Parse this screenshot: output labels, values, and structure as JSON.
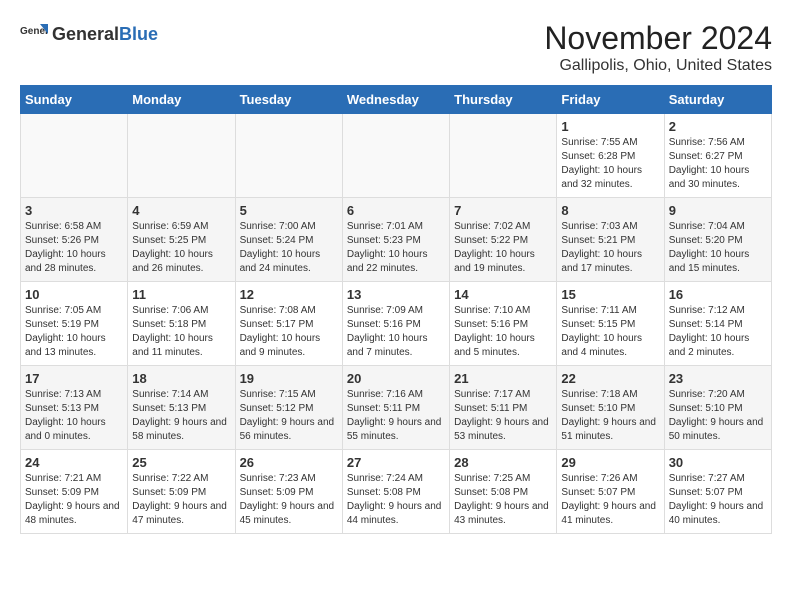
{
  "header": {
    "logo_general": "General",
    "logo_blue": "Blue",
    "month": "November 2024",
    "location": "Gallipolis, Ohio, United States"
  },
  "weekdays": [
    "Sunday",
    "Monday",
    "Tuesday",
    "Wednesday",
    "Thursday",
    "Friday",
    "Saturday"
  ],
  "weeks": [
    [
      {
        "day": "",
        "info": ""
      },
      {
        "day": "",
        "info": ""
      },
      {
        "day": "",
        "info": ""
      },
      {
        "day": "",
        "info": ""
      },
      {
        "day": "",
        "info": ""
      },
      {
        "day": "1",
        "info": "Sunrise: 7:55 AM\nSunset: 6:28 PM\nDaylight: 10 hours and 32 minutes."
      },
      {
        "day": "2",
        "info": "Sunrise: 7:56 AM\nSunset: 6:27 PM\nDaylight: 10 hours and 30 minutes."
      }
    ],
    [
      {
        "day": "3",
        "info": "Sunrise: 6:58 AM\nSunset: 5:26 PM\nDaylight: 10 hours and 28 minutes."
      },
      {
        "day": "4",
        "info": "Sunrise: 6:59 AM\nSunset: 5:25 PM\nDaylight: 10 hours and 26 minutes."
      },
      {
        "day": "5",
        "info": "Sunrise: 7:00 AM\nSunset: 5:24 PM\nDaylight: 10 hours and 24 minutes."
      },
      {
        "day": "6",
        "info": "Sunrise: 7:01 AM\nSunset: 5:23 PM\nDaylight: 10 hours and 22 minutes."
      },
      {
        "day": "7",
        "info": "Sunrise: 7:02 AM\nSunset: 5:22 PM\nDaylight: 10 hours and 19 minutes."
      },
      {
        "day": "8",
        "info": "Sunrise: 7:03 AM\nSunset: 5:21 PM\nDaylight: 10 hours and 17 minutes."
      },
      {
        "day": "9",
        "info": "Sunrise: 7:04 AM\nSunset: 5:20 PM\nDaylight: 10 hours and 15 minutes."
      }
    ],
    [
      {
        "day": "10",
        "info": "Sunrise: 7:05 AM\nSunset: 5:19 PM\nDaylight: 10 hours and 13 minutes."
      },
      {
        "day": "11",
        "info": "Sunrise: 7:06 AM\nSunset: 5:18 PM\nDaylight: 10 hours and 11 minutes."
      },
      {
        "day": "12",
        "info": "Sunrise: 7:08 AM\nSunset: 5:17 PM\nDaylight: 10 hours and 9 minutes."
      },
      {
        "day": "13",
        "info": "Sunrise: 7:09 AM\nSunset: 5:16 PM\nDaylight: 10 hours and 7 minutes."
      },
      {
        "day": "14",
        "info": "Sunrise: 7:10 AM\nSunset: 5:16 PM\nDaylight: 10 hours and 5 minutes."
      },
      {
        "day": "15",
        "info": "Sunrise: 7:11 AM\nSunset: 5:15 PM\nDaylight: 10 hours and 4 minutes."
      },
      {
        "day": "16",
        "info": "Sunrise: 7:12 AM\nSunset: 5:14 PM\nDaylight: 10 hours and 2 minutes."
      }
    ],
    [
      {
        "day": "17",
        "info": "Sunrise: 7:13 AM\nSunset: 5:13 PM\nDaylight: 10 hours and 0 minutes."
      },
      {
        "day": "18",
        "info": "Sunrise: 7:14 AM\nSunset: 5:13 PM\nDaylight: 9 hours and 58 minutes."
      },
      {
        "day": "19",
        "info": "Sunrise: 7:15 AM\nSunset: 5:12 PM\nDaylight: 9 hours and 56 minutes."
      },
      {
        "day": "20",
        "info": "Sunrise: 7:16 AM\nSunset: 5:11 PM\nDaylight: 9 hours and 55 minutes."
      },
      {
        "day": "21",
        "info": "Sunrise: 7:17 AM\nSunset: 5:11 PM\nDaylight: 9 hours and 53 minutes."
      },
      {
        "day": "22",
        "info": "Sunrise: 7:18 AM\nSunset: 5:10 PM\nDaylight: 9 hours and 51 minutes."
      },
      {
        "day": "23",
        "info": "Sunrise: 7:20 AM\nSunset: 5:10 PM\nDaylight: 9 hours and 50 minutes."
      }
    ],
    [
      {
        "day": "24",
        "info": "Sunrise: 7:21 AM\nSunset: 5:09 PM\nDaylight: 9 hours and 48 minutes."
      },
      {
        "day": "25",
        "info": "Sunrise: 7:22 AM\nSunset: 5:09 PM\nDaylight: 9 hours and 47 minutes."
      },
      {
        "day": "26",
        "info": "Sunrise: 7:23 AM\nSunset: 5:09 PM\nDaylight: 9 hours and 45 minutes."
      },
      {
        "day": "27",
        "info": "Sunrise: 7:24 AM\nSunset: 5:08 PM\nDaylight: 9 hours and 44 minutes."
      },
      {
        "day": "28",
        "info": "Sunrise: 7:25 AM\nSunset: 5:08 PM\nDaylight: 9 hours and 43 minutes."
      },
      {
        "day": "29",
        "info": "Sunrise: 7:26 AM\nSunset: 5:07 PM\nDaylight: 9 hours and 41 minutes."
      },
      {
        "day": "30",
        "info": "Sunrise: 7:27 AM\nSunset: 5:07 PM\nDaylight: 9 hours and 40 minutes."
      }
    ]
  ]
}
